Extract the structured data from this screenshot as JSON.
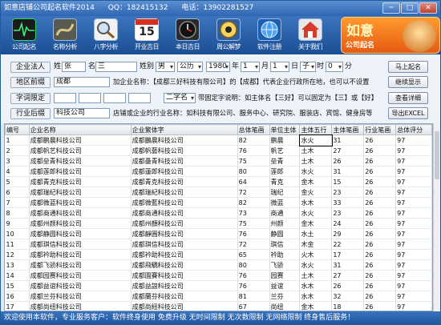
{
  "window": {
    "title": "如意店铺公司起名软件2014",
    "qq": "QQ：182415132",
    "phone": "电话：13902281527",
    "buttons": [
      "─",
      "□",
      "✕"
    ]
  },
  "toolbar": [
    {
      "label": "公司起名",
      "icon": "heartbeat-icon"
    },
    {
      "label": "名称分析",
      "icon": "rope-icon"
    },
    {
      "label": "八字分析",
      "icon": "magnifier-icon"
    },
    {
      "label": "开业吉日",
      "icon": "calendar-icon"
    },
    {
      "label": "本日吉日",
      "icon": "clock-icon"
    },
    {
      "label": "周公解梦",
      "icon": "bagua-icon"
    },
    {
      "label": "软件注册",
      "icon": "globe-icon"
    },
    {
      "label": "关于我们",
      "icon": "house-icon"
    }
  ],
  "calendar_day": "15",
  "logo": {
    "line1": "如意",
    "line2": "公司起名"
  },
  "form": {
    "legal_label": "企业法人",
    "surname_label": "姓",
    "surname_value": "张",
    "name_label": "名",
    "name_value": "三",
    "gender_label": "姓别",
    "gender_value": "男",
    "calendar_value": "公历",
    "year_value": "1980",
    "year_unit": "年",
    "month_value": "1",
    "month_unit": "月",
    "day_value": "1",
    "day_unit": "日",
    "hour_value": "子",
    "hour_unit": "时",
    "minute_value": "0",
    "minute_unit": "分",
    "region_label": "地区前缀",
    "region_value": "成都",
    "region_hint": "加企业名称：【成都三好科技有限公司】的【成都】代表企业行政所在地，也可以不设置",
    "fixed_label": "字词限定",
    "fixed_mode": "二字名",
    "fixed_hint": "带固定字说明：如主体名【三好】可以固定为【三】或【好】",
    "industry_label": "行业后缀",
    "industry_value": "科技公司",
    "industry_hint": "店铺或企业的行业名称：如科技有限公司、服务中心、研究院、服装店、宾馆、健身房等",
    "btn_start": "马上起名",
    "btn_continue": "继续显示",
    "btn_detail": "查看详细",
    "btn_export": "导出EXCEL"
  },
  "grid": {
    "headers": [
      "编号",
      "企业名称",
      "企业繁体字",
      "总体笔画",
      "单位主体",
      "主体五行",
      "主体笔画",
      "行业笔画",
      "总体评分"
    ],
    "rows": [
      [
        "1",
        "成都鹏晨科技公司",
        "成都鵬晨科技公司",
        "82",
        "鹏晨",
        "水火",
        "31",
        "26",
        "97"
      ],
      [
        "2",
        "成都帆艺科技公司",
        "成都帆藝科技公司",
        "76",
        "帆艺",
        "土木",
        "27",
        "26",
        "97"
      ],
      [
        "3",
        "成都垒青科技公司",
        "成都壘青科技公司",
        "75",
        "垒青",
        "土木",
        "26",
        "26",
        "97"
      ],
      [
        "4",
        "成都莲郎科技公司",
        "成都蓮郎科技公司",
        "80",
        "莲郎",
        "水火",
        "31",
        "26",
        "97"
      ],
      [
        "5",
        "成都青克科技公司",
        "成都青克科技公司",
        "64",
        "青克",
        "金木",
        "15",
        "26",
        "97"
      ],
      [
        "6",
        "成都瑞纪科技公司",
        "成都瑞紀科技公司",
        "72",
        "瑞纪",
        "金火",
        "23",
        "26",
        "97"
      ],
      [
        "7",
        "成都微蓝科技公司",
        "成都微藍科技公司",
        "82",
        "微蓝",
        "水木",
        "33",
        "26",
        "97"
      ],
      [
        "8",
        "成都商通科技公司",
        "成都商通科技公司",
        "73",
        "商通",
        "水火",
        "23",
        "26",
        "97"
      ],
      [
        "9",
        "成都州颜科技公司",
        "成都州顏科技公司",
        "75",
        "州颜",
        "金木",
        "24",
        "26",
        "97"
      ],
      [
        "10",
        "成都静圆科技公司",
        "成都靜圓科技公司",
        "76",
        "静圆",
        "水土",
        "29",
        "26",
        "97"
      ],
      [
        "11",
        "成都琪信科技公司",
        "成都琪信科技公司",
        "72",
        "琪信",
        "木金",
        "22",
        "26",
        "97"
      ],
      [
        "12",
        "成都衿助科技公司",
        "成都衿助科技公司",
        "65",
        "衿助",
        "火木",
        "17",
        "26",
        "97"
      ],
      [
        "13",
        "成都飞骄科技公司",
        "成都飛驕科技公司",
        "80",
        "飞骄",
        "水火",
        "31",
        "26",
        "97"
      ],
      [
        "14",
        "成都园赛科技公司",
        "成都園賽科技公司",
        "76",
        "园赛",
        "土木",
        "27",
        "26",
        "97"
      ],
      [
        "15",
        "成都益谊科技公司",
        "成都益誼科技公司",
        "76",
        "益谊",
        "水木",
        "26",
        "26",
        "97"
      ],
      [
        "16",
        "成都兰芬科技公司",
        "成都蘭芬科技公司",
        "81",
        "兰芬",
        "水木",
        "32",
        "26",
        "97"
      ],
      [
        "17",
        "成都尚纽科技公司",
        "成都尚紐科技公司",
        "67",
        "尚纽",
        "金木",
        "18",
        "26",
        "97"
      ]
    ]
  },
  "status": {
    "text": "欢迎使用本软件，专业服务客户：软件终身使用  免费升级  无时间限制  无次数限制  无网络限制  终身售后服务！"
  },
  "colors": {
    "titlebar": "#3a72bc",
    "toolbar": "#1c4e93",
    "logo": "#e65a12",
    "selected_cell_border": "#000000"
  }
}
